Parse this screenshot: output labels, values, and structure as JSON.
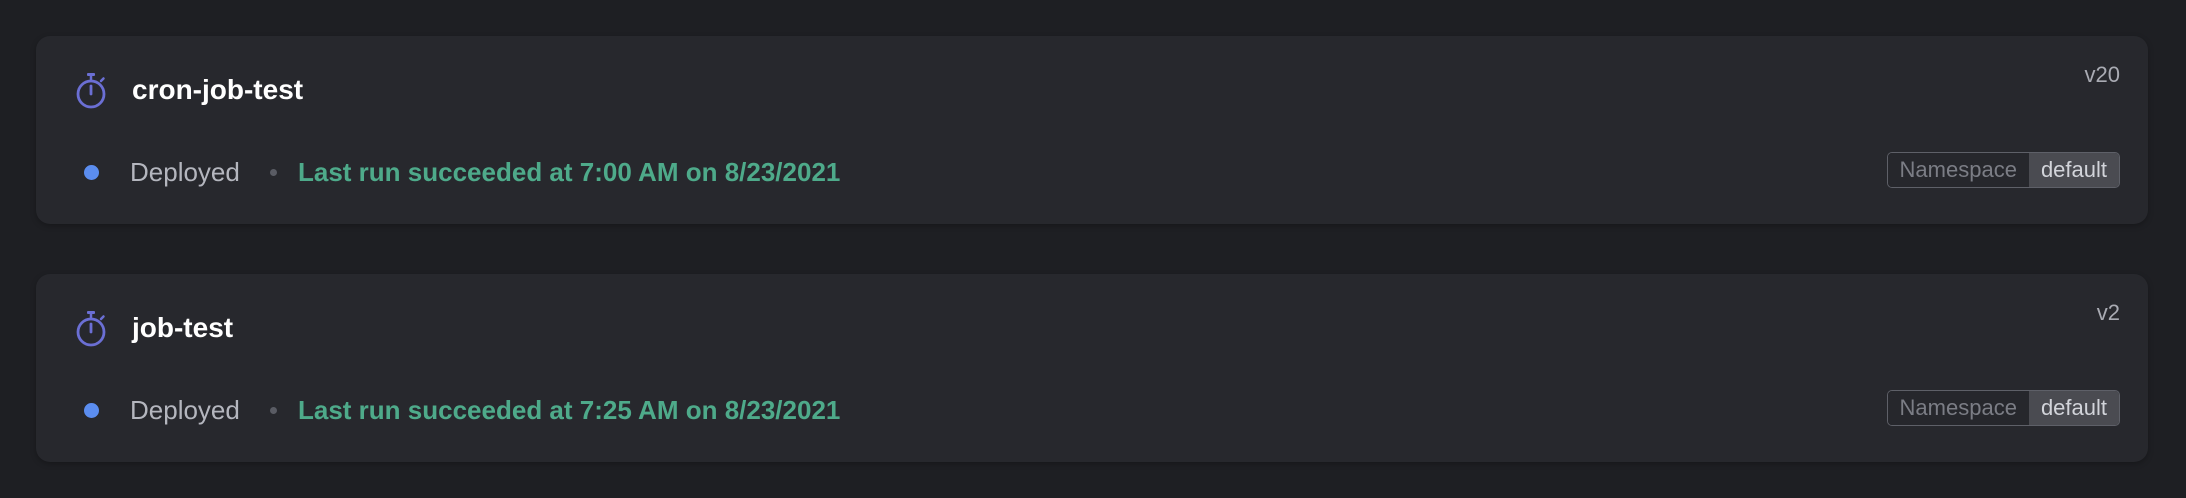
{
  "jobs": [
    {
      "name": "cron-job-test",
      "version": "v20",
      "status": "Deployed",
      "last_run": "Last run succeeded at 7:00 AM on 8/23/2021",
      "namespace_label": "Namespace",
      "namespace_value": "default",
      "icon": "stopwatch-icon"
    },
    {
      "name": "job-test",
      "version": "v2",
      "status": "Deployed",
      "last_run": "Last run succeeded at 7:25 AM on 8/23/2021",
      "namespace_label": "Namespace",
      "namespace_value": "default",
      "icon": "stopwatch-icon"
    }
  ],
  "colors": {
    "background": "#1e1f23",
    "card": "#27282d",
    "status_dot": "#5b8def",
    "success_text": "#4eaa8a",
    "icon": "#6b6fd4"
  }
}
